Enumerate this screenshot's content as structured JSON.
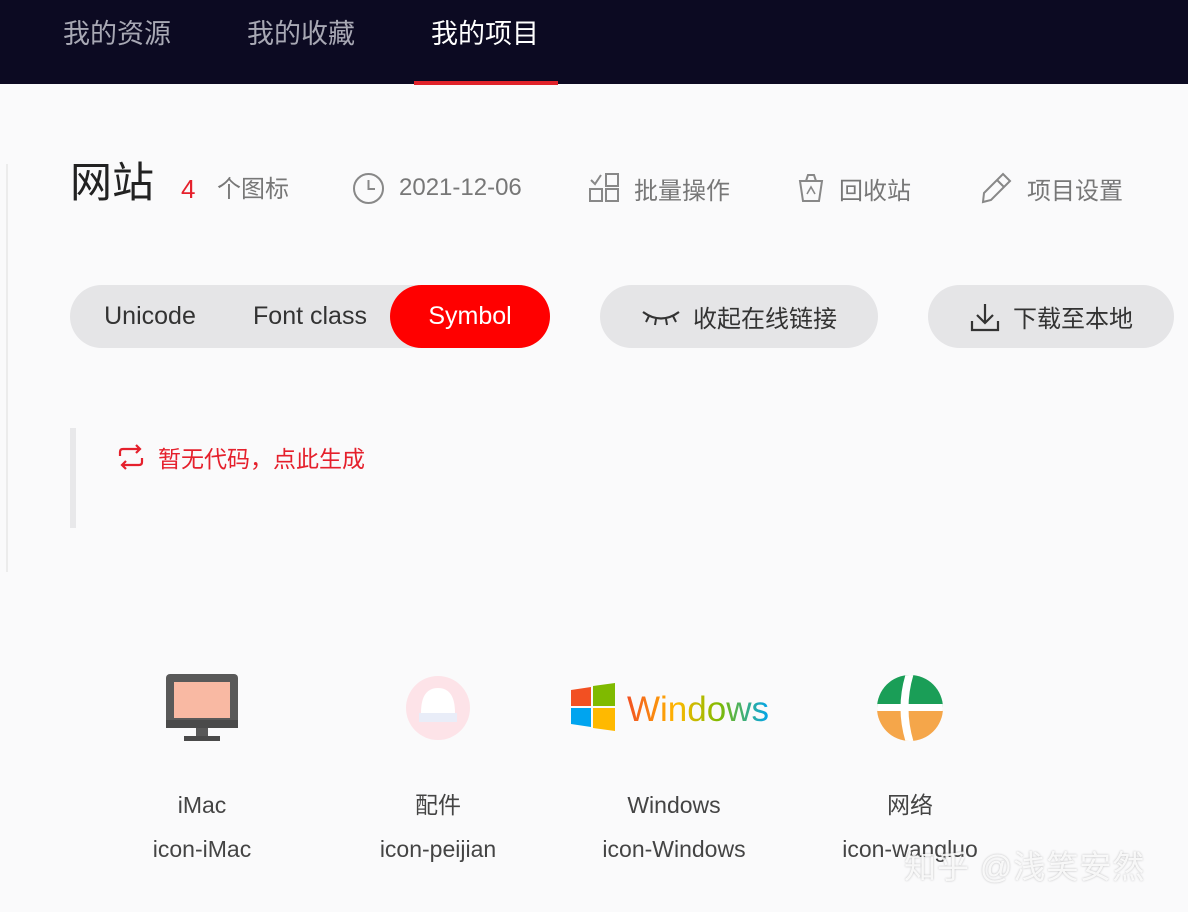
{
  "nav": {
    "tabs": [
      {
        "label": "我的资源",
        "active": false
      },
      {
        "label": "我的收藏",
        "active": false
      },
      {
        "label": "我的项目",
        "active": true
      }
    ]
  },
  "project": {
    "name": "网站",
    "icon_count": "4",
    "icon_count_label": "个图标",
    "date": "2021-12-06",
    "actions": {
      "batch": "批量操作",
      "recycle": "回收站",
      "settings": "项目设置"
    }
  },
  "code_tabs": {
    "items": [
      "Unicode",
      "Font class",
      "Symbol"
    ],
    "selected": "Symbol"
  },
  "buttons": {
    "collapse_link": "收起在线链接",
    "download": "下载至本地"
  },
  "code_panel": {
    "generate_text": "暂无代码，点此生成"
  },
  "icons": [
    {
      "name": "iMac",
      "code": "icon-iMac",
      "icon": "imac-icon"
    },
    {
      "name": "配件",
      "code": "icon-peijian",
      "icon": "accessory-icon"
    },
    {
      "name": "Windows",
      "code": "icon-Windows",
      "icon": "windows-logo-icon",
      "art_text": "Windows"
    },
    {
      "name": "网络",
      "code": "icon-wangluo",
      "icon": "globe-icon"
    }
  ],
  "watermark": "知乎 @浅笑安然",
  "colors": {
    "nav_bg": "#0c0a22",
    "accent": "#ff0000",
    "link_red": "#e5202c",
    "pill_bg": "#e5e5e7"
  }
}
